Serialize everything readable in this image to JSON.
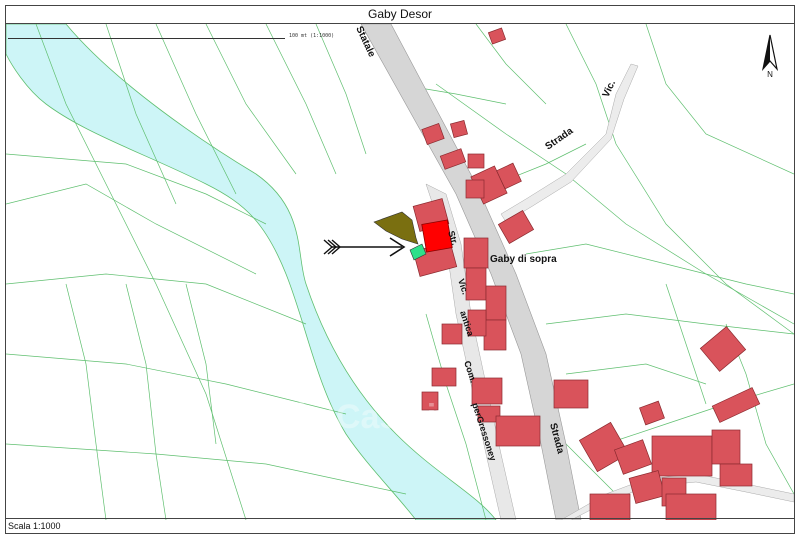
{
  "title": "Gaby Desor",
  "scale_label": "Scala 1:1000",
  "scalebar_text": "100 mt (1:1000)",
  "north_icon": "north-arrow-icon",
  "watermark": "Casa.it",
  "labels": {
    "statale": "Statale",
    "strada_vic": "Strada",
    "vic_top": "Vic.",
    "gaby_di_sopra": "Gaby di sopra",
    "str": "Str.",
    "vic_mid": "Vic.",
    "antica": "antica",
    "com": "Com.",
    "per_gressoney": "perGressoney",
    "strada_bottom": "Strada"
  },
  "colors": {
    "river": "#cdf5f7",
    "building": "#d9535b",
    "building_stroke": "#8a2a2f",
    "parcel_line": "#5fbf6f",
    "road": "#d6d6d6",
    "selected_parcel": "#ff0000",
    "olive_parcel": "#7a6f10",
    "green_parcel": "#2ee08a"
  }
}
